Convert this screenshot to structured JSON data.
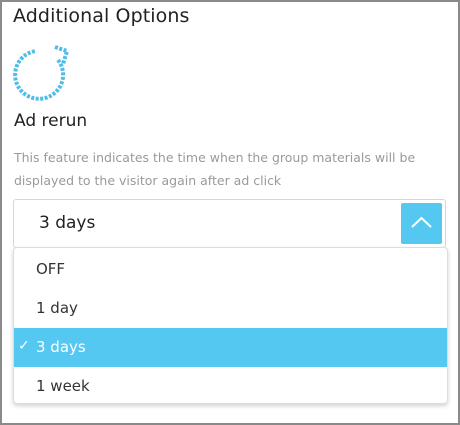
{
  "section": {
    "title": "Additional Options"
  },
  "feature": {
    "icon": "rerun-icon",
    "title": "Ad rerun",
    "description": "This feature indicates the time when the group materials will be displayed to the visitor again after ad click"
  },
  "select": {
    "value": "3 days",
    "toggle_icon": "chevron-up-icon",
    "options": [
      {
        "label": "OFF",
        "selected": false
      },
      {
        "label": "1 day",
        "selected": false
      },
      {
        "label": "3 days",
        "selected": true
      },
      {
        "label": "1 week",
        "selected": false
      }
    ],
    "check_mark": "✓"
  },
  "colors": {
    "accent": "#55c8f2",
    "text": "#222222",
    "muted": "#9a9a9a"
  }
}
